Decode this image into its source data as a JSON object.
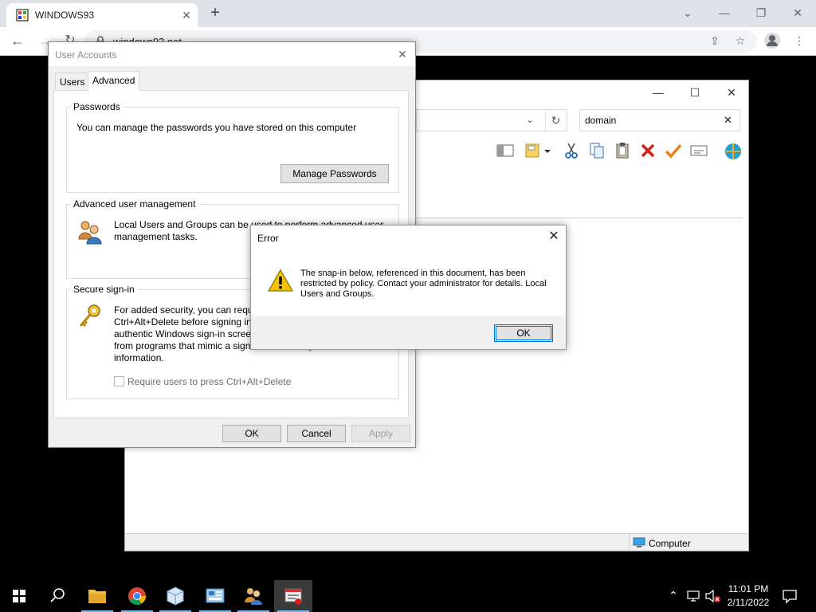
{
  "browser": {
    "tab_title": "WINDOWS93",
    "url": "windows93.net",
    "new_tab_symbol": "+",
    "tab_close_symbol": "✕"
  },
  "mmc": {
    "search_value": "domain",
    "status_text": "Computer"
  },
  "user_accounts": {
    "title": "User Accounts",
    "tabs": [
      {
        "label": "Users",
        "selected": false
      },
      {
        "label": "Advanced",
        "selected": true
      }
    ],
    "passwords": {
      "title": "Passwords",
      "text": "You can manage the passwords you have stored on this computer",
      "button_label": "Manage Passwords"
    },
    "advanced": {
      "title": "Advanced user management",
      "text": "Local Users and Groups can be used to perform advanced user management tasks."
    },
    "secure": {
      "title": "Secure sign-in",
      "text": "For added security, you can require users to press Ctrl+Alt+Delete before signing in. This guarantees that the authentic Windows sign-in screen appears, protecting the system from programs that mimic a sign-in to retrieve password information.",
      "checkbox_label": "Require users to press Ctrl+Alt+Delete",
      "checkbox_checked": false,
      "checkbox_enabled": false
    },
    "buttons": {
      "ok": "OK",
      "cancel": "Cancel",
      "apply": "Apply"
    }
  },
  "error_dialog": {
    "title": "Error",
    "message": "The snap-in below, referenced in this document, has been restricted by policy. Contact your administrator for details. Local Users and Groups.",
    "ok_label": "OK",
    "icon": "warning-icon"
  },
  "taskbar": {
    "time": "11:01 PM",
    "date": "2/11/2022",
    "pinned": [
      "start-icon",
      "search-icon",
      "file-explorer-icon",
      "chrome-icon",
      "virtualbox-icon",
      "control-panel-icon",
      "users-icon",
      "mmc-icon"
    ]
  },
  "colors": {
    "accent": "#0078d7",
    "taskbar_active": "#76b9ed",
    "warning": "#f5c400",
    "delete_red": "#d81e1e",
    "check_orange": "#e8841a"
  }
}
